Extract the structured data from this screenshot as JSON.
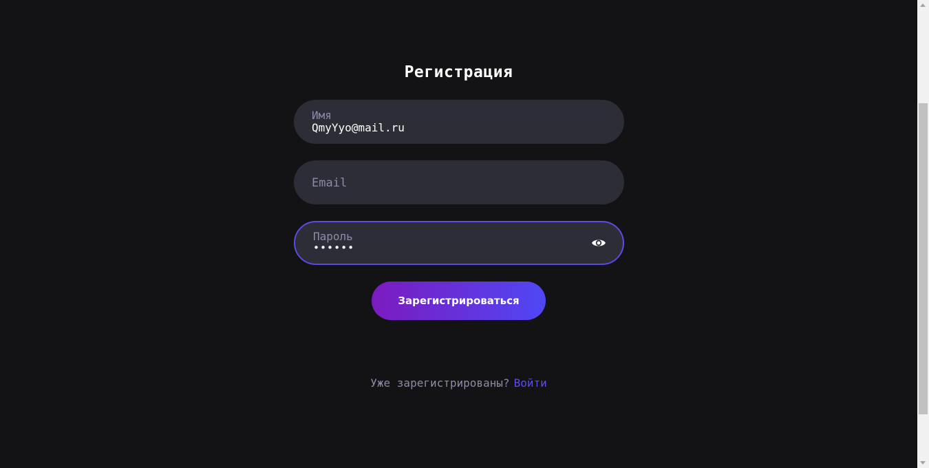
{
  "form": {
    "title": "Регистрация",
    "name_field": {
      "label": "Имя",
      "value": "QmyYyo@mail.ru"
    },
    "email_field": {
      "label": "Email",
      "value": ""
    },
    "password_field": {
      "label": "Пароль",
      "value": "••••••"
    },
    "submit_label": "Зарегистрироваться"
  },
  "footer": {
    "prompt": "Уже зарегистрированы?",
    "link_label": "Войти"
  },
  "icons": {
    "password_toggle": "eye-icon"
  },
  "colors": {
    "background": "#131316",
    "field_background": "#2d2d37",
    "focus_border": "#5b4be6",
    "button_gradient_start": "#7b1bbf",
    "button_gradient_end": "#5047f5",
    "link": "#5b4bf0",
    "muted_text": "#8f8aa6"
  }
}
